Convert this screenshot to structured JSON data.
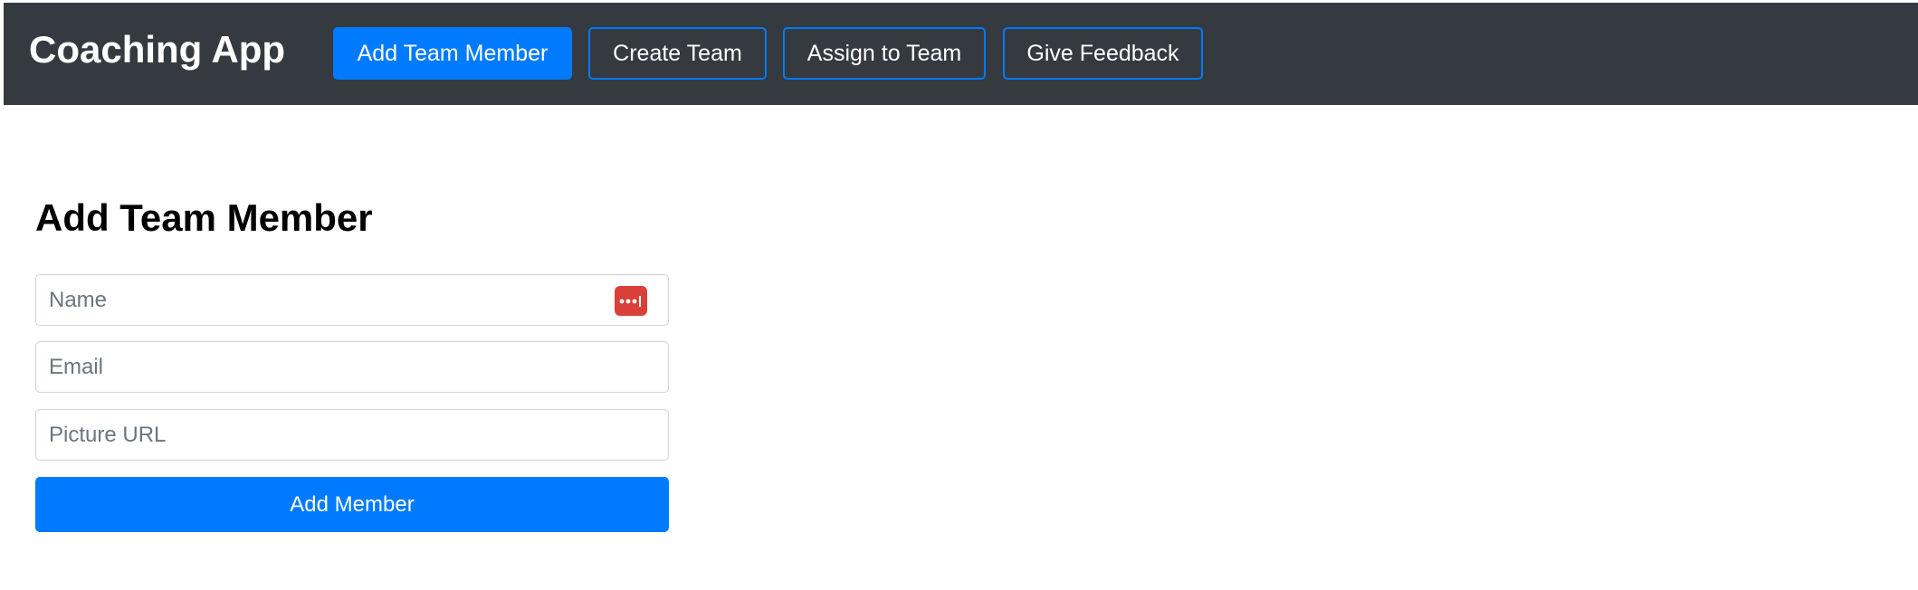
{
  "navbar": {
    "brand": "Coaching App",
    "buttons": [
      {
        "label": "Add Team Member",
        "active": true
      },
      {
        "label": "Create Team",
        "active": false
      },
      {
        "label": "Assign to Team",
        "active": false
      },
      {
        "label": "Give Feedback",
        "active": false
      }
    ]
  },
  "form": {
    "heading": "Add Team Member",
    "fields": [
      {
        "placeholder": "Name",
        "value": "",
        "icon": "password-manager-icon"
      },
      {
        "placeholder": "Email",
        "value": ""
      },
      {
        "placeholder": "Picture URL",
        "value": ""
      }
    ],
    "submit_label": "Add Member"
  },
  "colors": {
    "navbar_bg": "#343a40",
    "primary": "#007bff",
    "password_manager_icon": "#d9403a",
    "field_border": "#ced4da"
  }
}
